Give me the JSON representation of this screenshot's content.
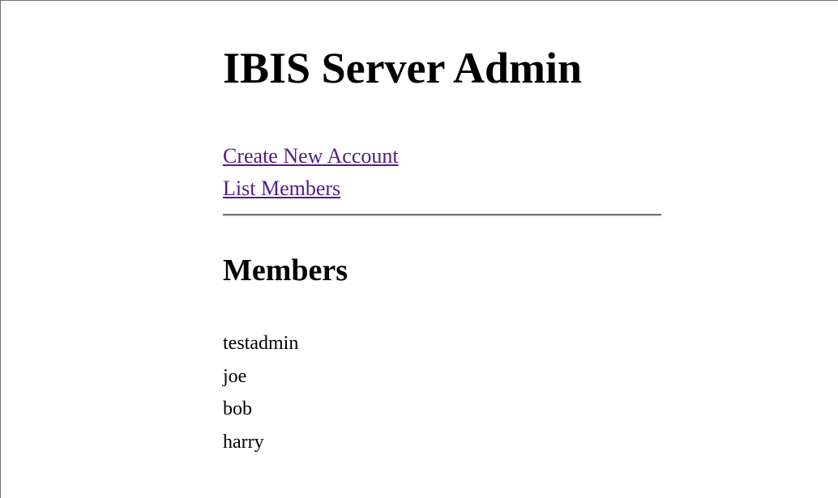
{
  "header": {
    "title": "IBIS Server Admin"
  },
  "nav": {
    "links": [
      {
        "label": "Create New Account"
      },
      {
        "label": "List Members"
      }
    ],
    "link_color": "#551a8b"
  },
  "members": {
    "heading": "Members",
    "items": [
      "testadmin",
      "joe",
      "bob",
      "harry"
    ]
  }
}
